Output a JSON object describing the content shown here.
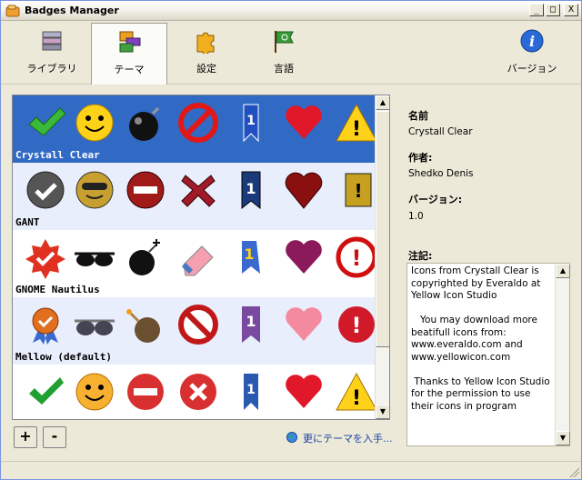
{
  "window": {
    "title": "Badges Manager"
  },
  "titlebar_buttons": {
    "minimize": "_",
    "maximize": "□",
    "close": "X"
  },
  "toolbar": {
    "items": [
      {
        "label": "ライブラリ",
        "icon": "library-icon"
      },
      {
        "label": "テーマ",
        "icon": "theme-icon",
        "active": true
      },
      {
        "label": "設定",
        "icon": "puzzle-settings-icon"
      },
      {
        "label": "言語",
        "icon": "language-flag-icon"
      }
    ],
    "version_label": "バージョン",
    "version_icon": "info-icon"
  },
  "themes": [
    {
      "name": "Crystall Clear",
      "selected": true,
      "badges": [
        "check-icon",
        "smiley-icon",
        "bomb-icon",
        "forbidden-icon",
        "ribbon-icon",
        "heart-icon",
        "warning-icon"
      ]
    },
    {
      "name": "GANT",
      "badges": [
        "check-icon",
        "smiley-icon",
        "minus-icon",
        "x-icon",
        "ribbon-icon",
        "heart-icon",
        "warning-icon"
      ]
    },
    {
      "name": "GNOME Nautilus",
      "badges": [
        "star-check-icon",
        "sunglasses-icon",
        "bomb-icon",
        "eraser-icon",
        "ribbon-icon",
        "heart-icon",
        "exclamation-icon"
      ]
    },
    {
      "name": "Mellow (default)",
      "badges": [
        "award-icon",
        "sunglasses-icon",
        "bomb-icon",
        "forbidden-icon",
        "ribbon-icon",
        "heart-icon",
        "exclamation-icon"
      ]
    },
    {
      "name": "",
      "badges": [
        "check-icon",
        "smiley-icon",
        "minus-icon",
        "x-icon",
        "ribbon-icon",
        "heart-icon",
        "warning-icon"
      ]
    }
  ],
  "list_buttons": {
    "add": "+",
    "remove": "-"
  },
  "more_themes_link": "更にテーマを入手...",
  "details": {
    "name_label": "名前",
    "name_value": "Crystall Clear",
    "author_label": "作者:",
    "author_value": "Shedko Denis",
    "version_label": "バージョン:",
    "version_value": "1.0",
    "notes_label": "注記:",
    "notes_text": "Icons from Crystall Clear is copyrighted by Everaldo at Yellow Icon Studio\n\n   You may download more beatifull icons from:\nwww.everaldo.com and www.yellowicon.com\n\n Thanks to Yellow Icon Studio for the permission to use their icons in program"
  },
  "colors": {
    "selection": "#316ac5",
    "link": "#1941a5"
  }
}
